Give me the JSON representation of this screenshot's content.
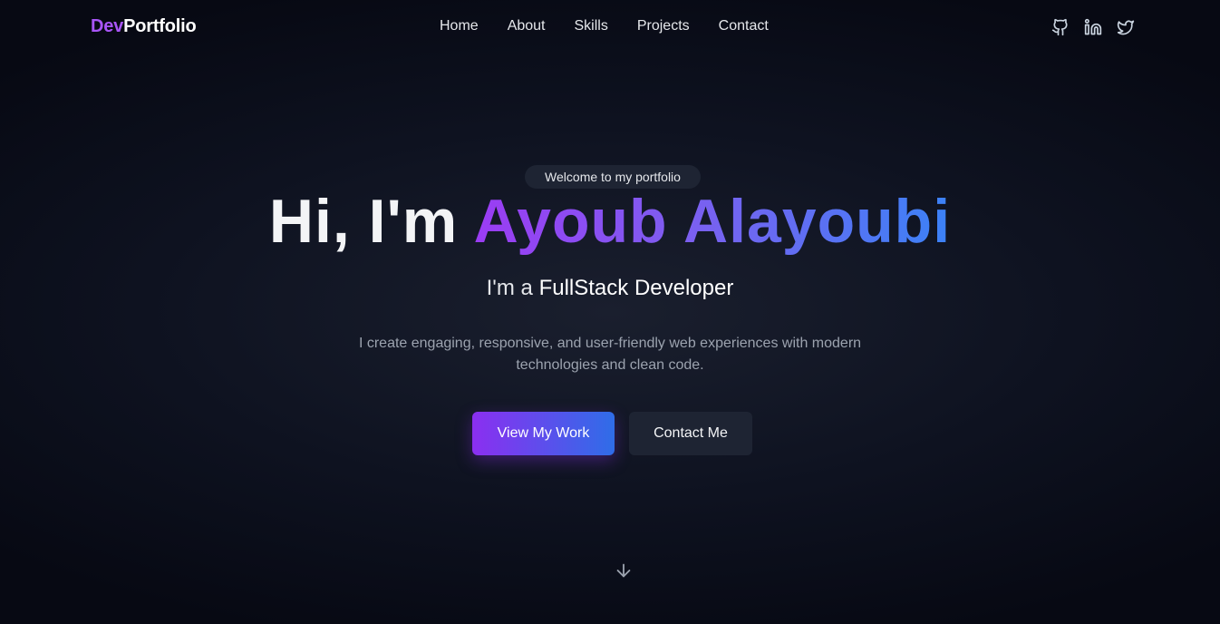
{
  "nav": {
    "logo_accent": "Dev",
    "logo_rest": "Portfolio",
    "items": [
      {
        "label": "Home"
      },
      {
        "label": "About"
      },
      {
        "label": "Skills"
      },
      {
        "label": "Projects"
      },
      {
        "label": "Contact"
      }
    ],
    "social": [
      "github-icon",
      "linkedin-icon",
      "twitter-icon"
    ]
  },
  "hero": {
    "badge": "Welcome to my portfolio",
    "greeting": "Hi, I'm ",
    "name": "Ayoub Alayoubi",
    "role_prefix": "I'm a ",
    "role": "FullStack Developer",
    "description": "I create engaging, responsive, and user-friendly web experiences with modern technologies and clean code.",
    "primary_button": "View My Work",
    "secondary_button": "Contact Me"
  },
  "colors": {
    "accent": "#a855f7",
    "gradient_start": "#9b3cf3",
    "gradient_end": "#3b82f6",
    "background": "#0e1220"
  }
}
